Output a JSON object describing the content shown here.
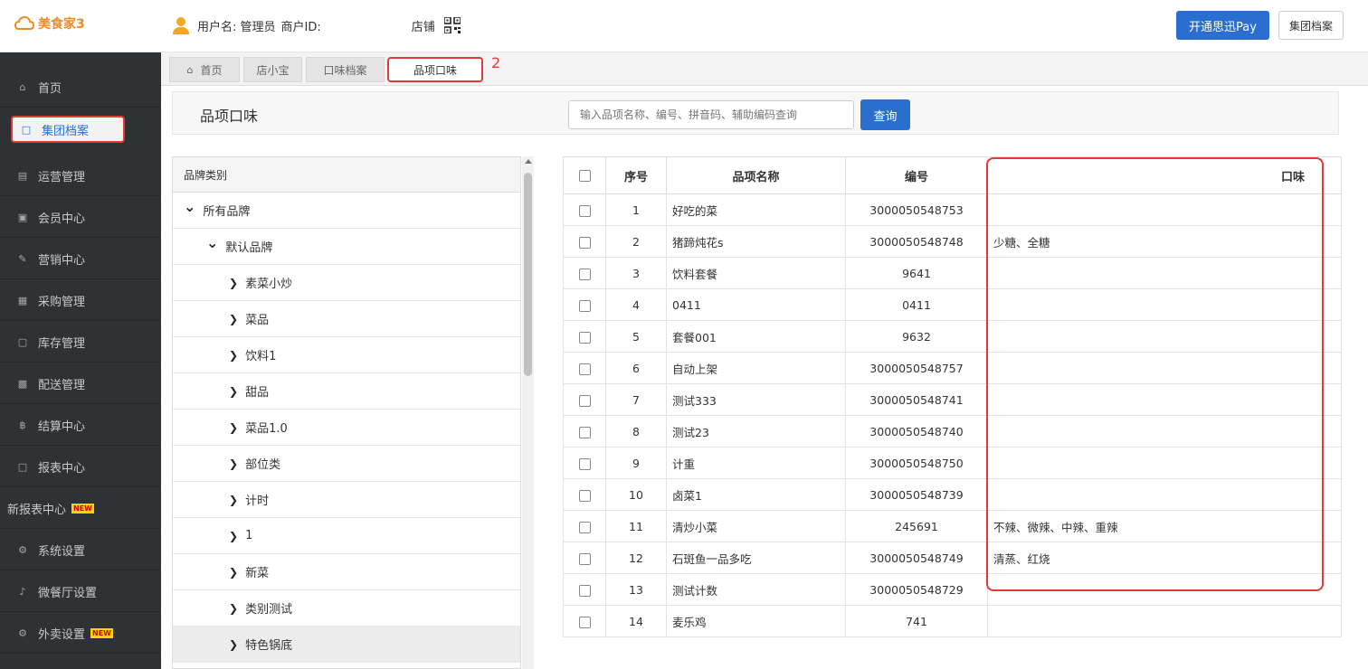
{
  "header": {
    "logo_text": "美食家3",
    "username_label": "用户名: 管理员",
    "merchant_label": "商户ID:",
    "store_label": "店铺",
    "pay_button": "开通思迅Pay",
    "archive_button": "集团档案"
  },
  "sidebar": {
    "items": [
      {
        "label": "首页",
        "icon": "home-icon"
      },
      {
        "label": "集团档案",
        "icon": "document-icon"
      },
      {
        "label": "运营管理",
        "icon": "chart-icon"
      },
      {
        "label": "会员中心",
        "icon": "id-card-icon"
      },
      {
        "label": "营销中心",
        "icon": "edit-icon"
      },
      {
        "label": "采购管理",
        "icon": "book-icon"
      },
      {
        "label": "库存管理",
        "icon": "box-icon"
      },
      {
        "label": "配送管理",
        "icon": "truck-icon"
      },
      {
        "label": "结算中心",
        "icon": "coin-icon"
      },
      {
        "label": "报表中心",
        "icon": "report-icon"
      },
      {
        "label": "新报表中心",
        "icon": "",
        "badge": "NEW"
      },
      {
        "label": "系统设置",
        "icon": "gears-icon"
      },
      {
        "label": "微餐厅设置",
        "icon": "utensils-icon"
      },
      {
        "label": "外卖设置",
        "icon": "gear-icon",
        "badge": "NEW"
      }
    ]
  },
  "tabs": [
    {
      "label": "首页",
      "icon": "home-icon"
    },
    {
      "label": "店小宝"
    },
    {
      "label": "口味档案"
    },
    {
      "label": "品项口味"
    }
  ],
  "annotation_mark": "2",
  "page": {
    "title": "品项口味",
    "search_placeholder": "输入品项名称、编号、拼音码、辅助编码查询",
    "search_button": "查询"
  },
  "tree": {
    "header": "品牌类别",
    "nodes": [
      {
        "label": "所有品牌",
        "expanded": true,
        "level": 0
      },
      {
        "label": "默认品牌",
        "expanded": true,
        "level": 1
      },
      {
        "label": "素菜小炒",
        "expanded": false,
        "level": 2
      },
      {
        "label": "菜品",
        "expanded": false,
        "level": 2
      },
      {
        "label": "饮料1",
        "expanded": false,
        "level": 2
      },
      {
        "label": "甜品",
        "expanded": false,
        "level": 2
      },
      {
        "label": "菜品1.0",
        "expanded": false,
        "level": 2
      },
      {
        "label": "部位类",
        "expanded": false,
        "level": 2
      },
      {
        "label": "计时",
        "expanded": false,
        "level": 2
      },
      {
        "label": "1",
        "expanded": false,
        "level": 2
      },
      {
        "label": "新菜",
        "expanded": false,
        "level": 2
      },
      {
        "label": "类别测试",
        "expanded": false,
        "level": 2
      },
      {
        "label": "特色锅底",
        "expanded": false,
        "level": 2,
        "selected": true
      }
    ]
  },
  "table": {
    "columns": [
      "序号",
      "品项名称",
      "编号",
      "口味"
    ],
    "rows": [
      {
        "no": "1",
        "name": "好吃的菜",
        "code": "3000050548753",
        "flavor": ""
      },
      {
        "no": "2",
        "name": "猪蹄炖花s",
        "code": "3000050548748",
        "flavor": "少糖、全糖"
      },
      {
        "no": "3",
        "name": "饮料套餐",
        "code": "9641",
        "flavor": ""
      },
      {
        "no": "4",
        "name": "0411",
        "code": "0411",
        "flavor": ""
      },
      {
        "no": "5",
        "name": "套餐001",
        "code": "9632",
        "flavor": ""
      },
      {
        "no": "6",
        "name": "自动上架",
        "code": "3000050548757",
        "flavor": ""
      },
      {
        "no": "7",
        "name": "测试333",
        "code": "3000050548741",
        "flavor": ""
      },
      {
        "no": "8",
        "name": "测试23",
        "code": "3000050548740",
        "flavor": ""
      },
      {
        "no": "9",
        "name": "计重",
        "code": "3000050548750",
        "flavor": ""
      },
      {
        "no": "10",
        "name": "卤菜1",
        "code": "3000050548739",
        "flavor": ""
      },
      {
        "no": "11",
        "name": "清炒小菜",
        "code": "245691",
        "flavor": "不辣、微辣、中辣、重辣"
      },
      {
        "no": "12",
        "name": "石斑鱼一品多吃",
        "code": "3000050548749",
        "flavor": "清蒸、红烧"
      },
      {
        "no": "13",
        "name": "测试计数",
        "code": "3000050548729",
        "flavor": ""
      },
      {
        "no": "14",
        "name": "麦乐鸡",
        "code": "741",
        "flavor": ""
      }
    ]
  },
  "colors": {
    "accent": "#2a6fcf",
    "highlight": "#e53935",
    "sidebar_bg": "#2f3235",
    "logo": "#f08a24"
  }
}
